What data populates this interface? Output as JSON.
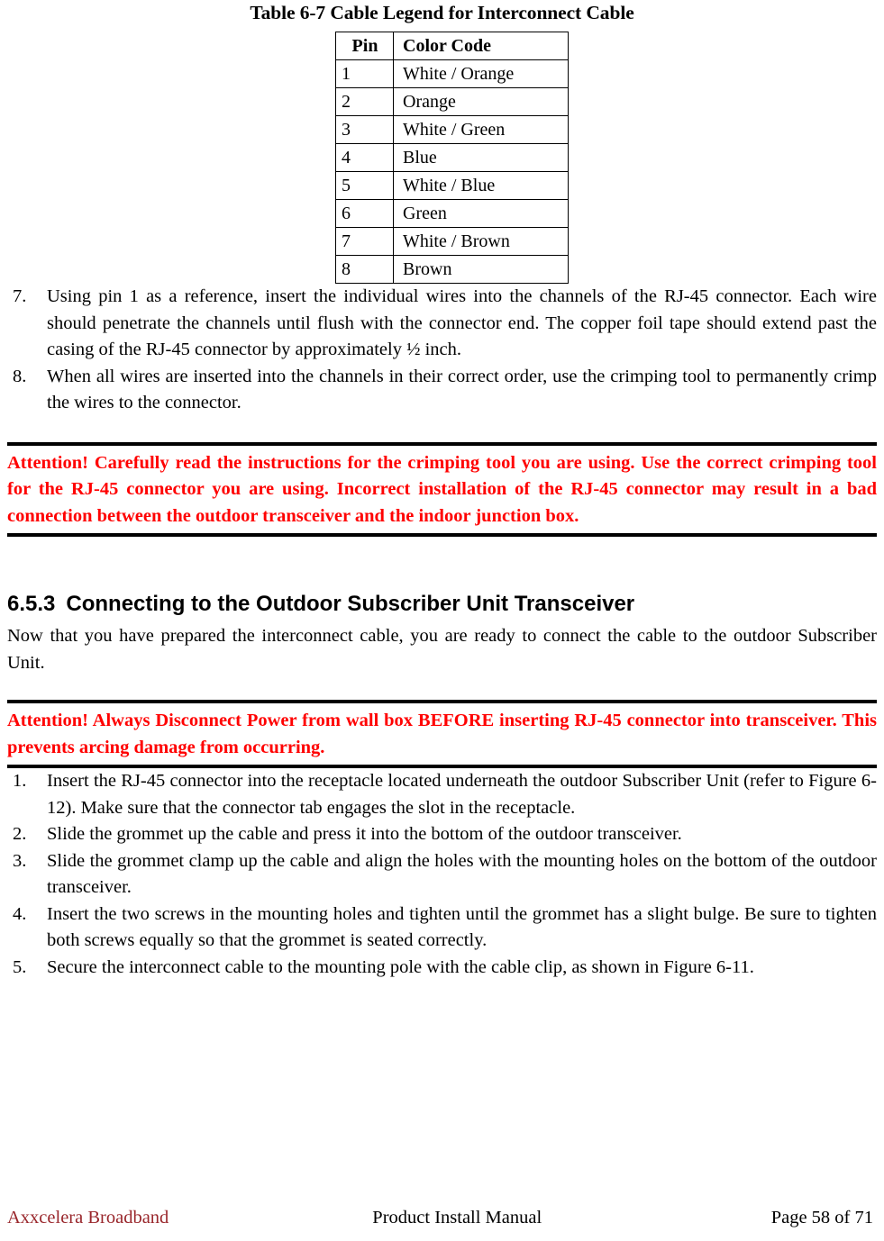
{
  "document": {
    "table_caption": "Table 6-7 Cable Legend for Interconnect Cable"
  },
  "pin_table": {
    "headers": [
      "Pin",
      "Color Code"
    ],
    "rows": [
      {
        "pin": "1",
        "color_code": "White / Orange"
      },
      {
        "pin": "2",
        "color_code": "Orange"
      },
      {
        "pin": "3",
        "color_code": "White / Green"
      },
      {
        "pin": "4",
        "color_code": "Blue"
      },
      {
        "pin": "5",
        "color_code": "White / Blue"
      },
      {
        "pin": "6",
        "color_code": "Green"
      },
      {
        "pin": "7",
        "color_code": "White / Brown"
      },
      {
        "pin": "8",
        "color_code": "Brown"
      }
    ]
  },
  "steps_crimping": [
    {
      "marker": "7.",
      "text": "Using pin 1 as a reference, insert the individual wires into the channels of the RJ-45 connector.  Each wire should penetrate the channels until flush with the connector end.  The copper foil tape should extend past the casing of the RJ-45 connector by approximately ½ inch."
    },
    {
      "marker": "8.",
      "text": "When all wires are inserted into the channels in their correct order, use the crimping tool to permanently crimp the wires to the connector."
    }
  ],
  "attention_1": {
    "text": "Attention!  Carefully read the instructions for the crimping tool you are using.  Use the correct crimping tool for the RJ-45 connector you are using.  Incorrect installation of the RJ-45 connector may result in a bad connection between the outdoor transceiver and the indoor junction box.",
    "color": "#ff0000"
  },
  "section": {
    "number": "6.5.3",
    "title": "Connecting to the Outdoor Subscriber Unit Transceiver",
    "body": "Now that you have prepared the interconnect cable, you are ready to connect the cable to the outdoor Subscriber Unit."
  },
  "attention_2": {
    "text": "Attention!  Always Disconnect Power from wall box BEFORE inserting RJ-45 connector into transceiver.  This prevents arcing damage from occurring.",
    "color": "#ff0000"
  },
  "steps_connecting": [
    {
      "marker": "1.",
      "text": "Insert the RJ-45 connector into the receptacle located underneath the outdoor Subscriber Unit (refer to Figure 6-12).  Make sure that the connector tab engages the slot in the receptacle."
    },
    {
      "marker": "2.",
      "text": "Slide the grommet up the cable and press it into the bottom of the outdoor transceiver."
    },
    {
      "marker": "3.",
      "text": "Slide the grommet clamp up the cable and align the holes with the mounting holes on the bottom of the outdoor transceiver."
    },
    {
      "marker": "4.",
      "text": "Insert the two screws in the mounting holes and tighten until the grommet has a slight bulge. Be sure to tighten both screws equally so that the grommet is seated correctly."
    },
    {
      "marker": "5.",
      "text": "Secure the interconnect cable to the mounting pole with the cable clip, as shown in Figure 6-11."
    }
  ],
  "footer": {
    "company": "Axxcelera Broadband",
    "manual_title": "Product Install Manual",
    "page_label": "Page 58 of 71",
    "company_color": "#99262b"
  }
}
